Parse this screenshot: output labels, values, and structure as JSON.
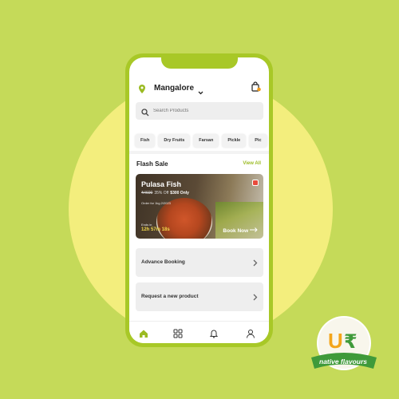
{
  "header": {
    "city": "Mangalore",
    "icons": [
      "location-pin-icon",
      "chevron-down-icon",
      "shopping-bag-icon"
    ]
  },
  "search": {
    "placeholder": "Search Products"
  },
  "categories": [
    "Fish",
    "Dry Fruits",
    "Farsan",
    "Pickle",
    "Pic"
  ],
  "flash_sale": {
    "title": "Flash Sale",
    "view_all": "View All",
    "product": {
      "name": "Pulasa Fish",
      "old_price": "₹4600",
      "discount": "35% Off",
      "price": "$300 Only",
      "note": "Order for 1kg 2/2023",
      "ends_label": "Ends in",
      "time_left": "12h 57m 18s",
      "cta": "Book Now"
    }
  },
  "cards": [
    {
      "label": "Advance Booking"
    },
    {
      "label": "Request a new product"
    }
  ],
  "tabbar": {
    "icons": [
      "home-icon",
      "grid-icon",
      "bell-icon",
      "user-icon"
    ]
  },
  "brand": {
    "logo_text": "native flavours"
  },
  "colors": {
    "accent": "#9bbb23",
    "background": "#c5da59",
    "circle": "#f3ee7d",
    "logo_ribbon": "#3f9a3a",
    "logo_orange": "#f3a51b"
  }
}
